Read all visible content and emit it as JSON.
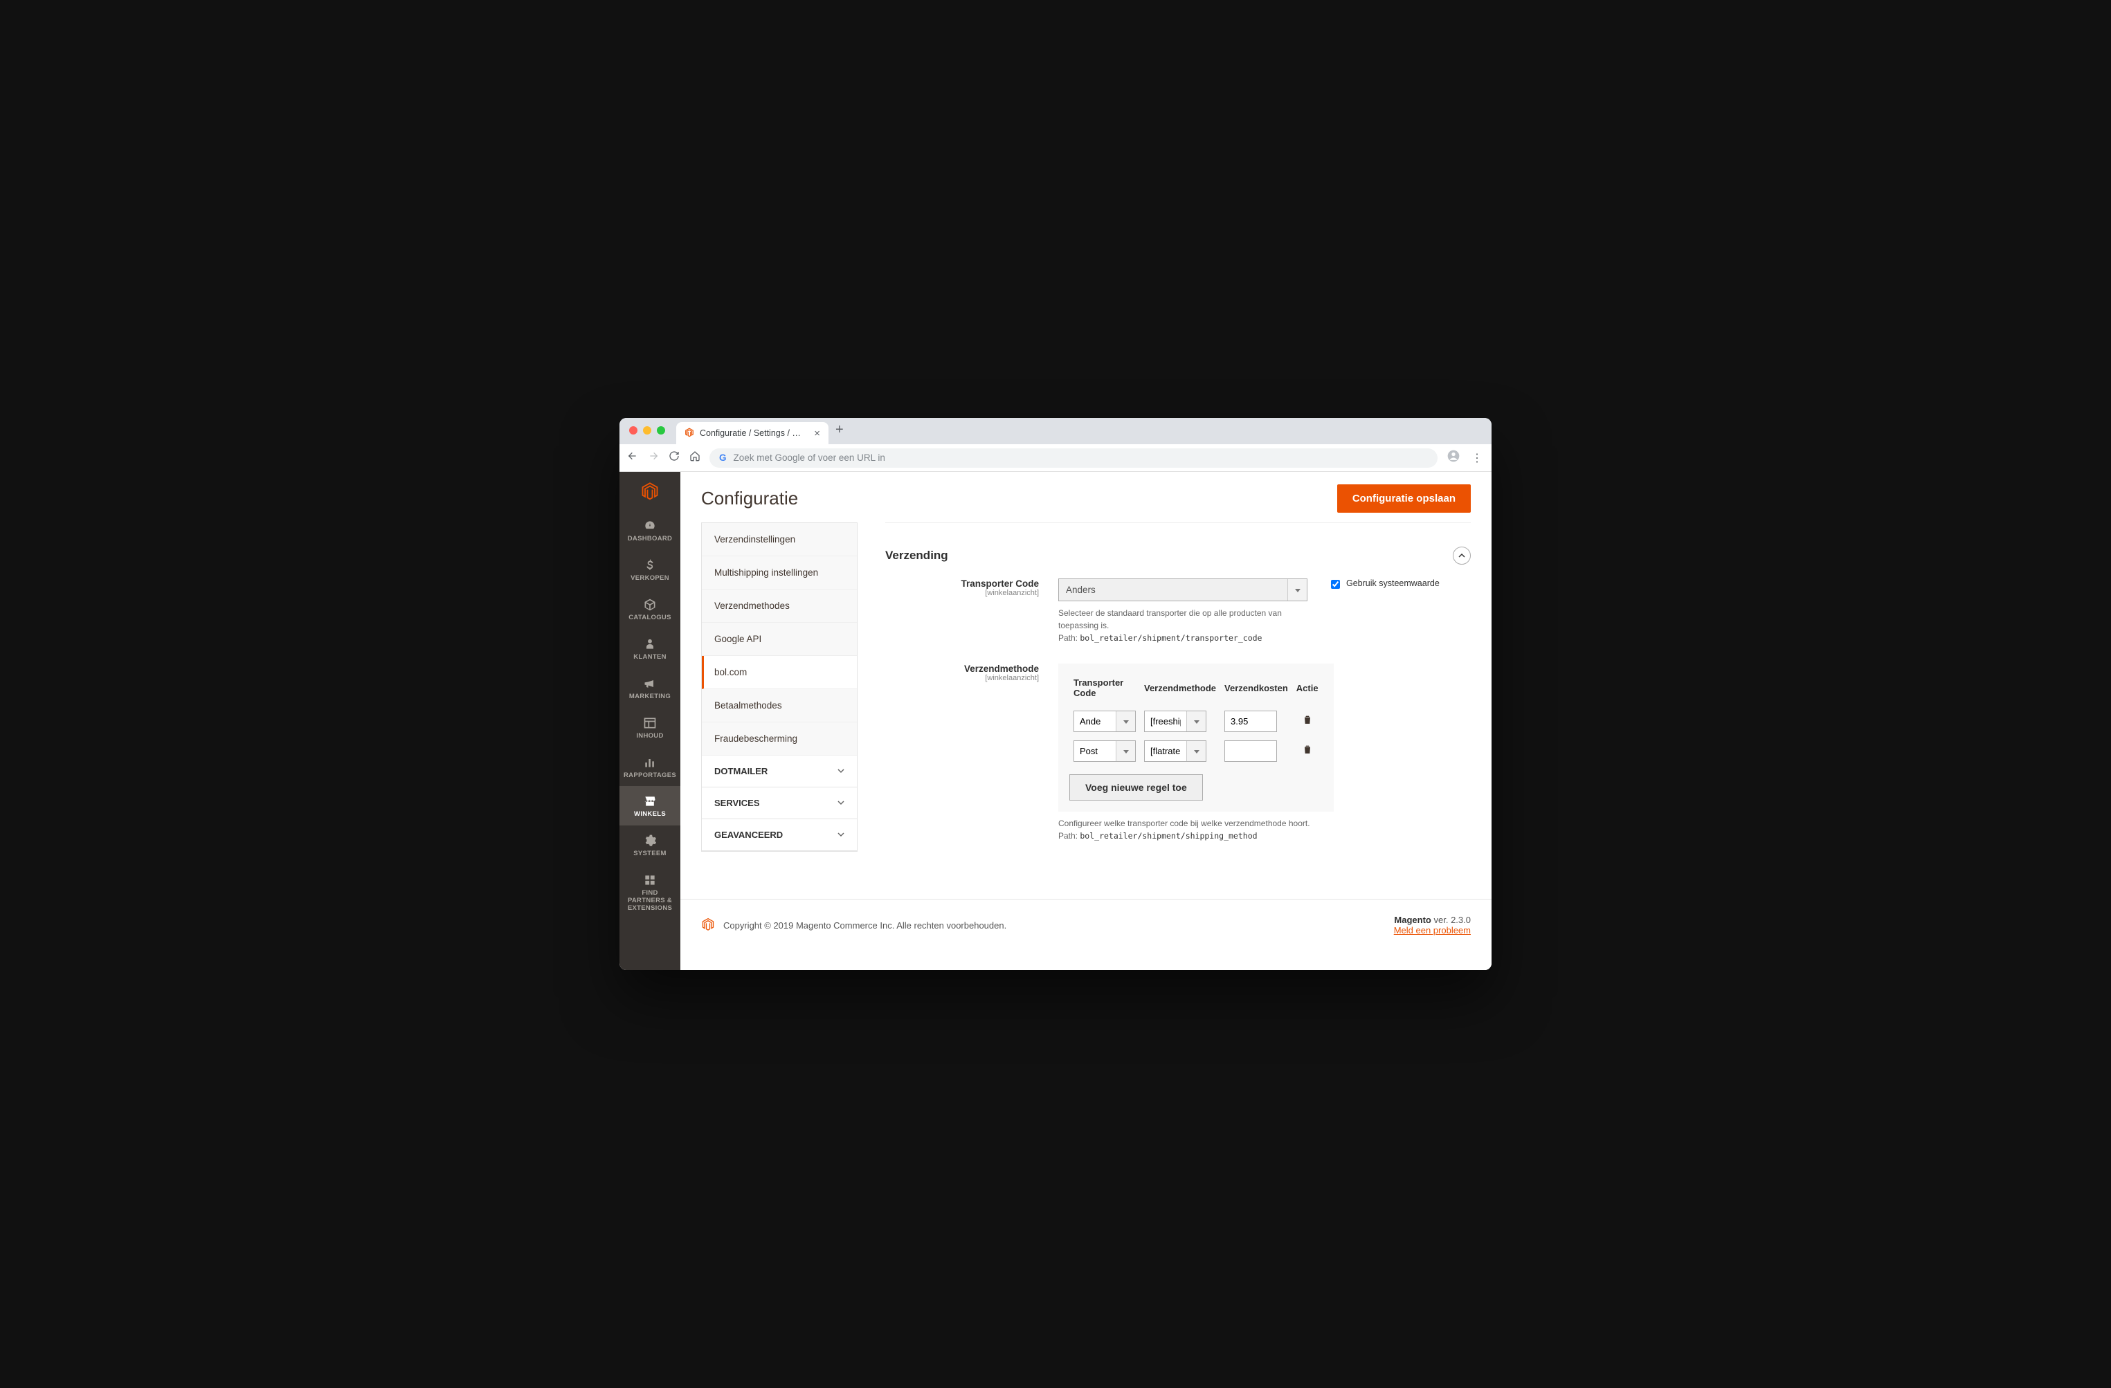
{
  "browser": {
    "tab_title": "Configuratie / Settings / Stores",
    "url_placeholder": "Zoek met Google of voer een URL in"
  },
  "sidebar_nav": [
    {
      "id": "dashboard",
      "label": "DASHBOARD",
      "icon": "gauge"
    },
    {
      "id": "verkopen",
      "label": "VERKOPEN",
      "icon": "dollar"
    },
    {
      "id": "catalogus",
      "label": "CATALOGUS",
      "icon": "box"
    },
    {
      "id": "klanten",
      "label": "KLANTEN",
      "icon": "person"
    },
    {
      "id": "marketing",
      "label": "MARKETING",
      "icon": "megaphone"
    },
    {
      "id": "inhoud",
      "label": "INHOUD",
      "icon": "layout"
    },
    {
      "id": "rapportages",
      "label": "RAPPORTAGES",
      "icon": "bars"
    },
    {
      "id": "winkels",
      "label": "WINKELS",
      "icon": "store",
      "active": true
    },
    {
      "id": "systeem",
      "label": "SYSTEEM",
      "icon": "gear"
    },
    {
      "id": "partners",
      "label": "FIND PARTNERS & EXTENSIONS",
      "icon": "blocks"
    }
  ],
  "page": {
    "title": "Configuratie",
    "save_button": "Configuratie opslaan"
  },
  "config_nav": {
    "items": [
      "Verzendinstellingen",
      "Multishipping instellingen",
      "Verzendmethodes",
      "Google API",
      "bol.com",
      "Betaalmethodes",
      "Fraudebescherming"
    ],
    "active_index": 4,
    "sections": [
      "DOTMAILER",
      "SERVICES",
      "GEAVANCEERD"
    ]
  },
  "fieldset": {
    "title": "Verzending",
    "transporter_code": {
      "label": "Transporter Code",
      "scope": "[winkelaanzicht]",
      "value": "Anders",
      "help": "Selecteer de standaard transporter die op alle producten van toepassing is.",
      "path_label": "Path:",
      "path": "bol_retailer/shipment/transporter_code",
      "use_default_label": "Gebruik systeemwaarde",
      "use_default_checked": true
    },
    "shipping_method": {
      "label": "Verzendmethode",
      "scope": "[winkelaanzicht]",
      "columns": [
        "Transporter Code",
        "Verzendmethode",
        "Verzendkosten",
        "Actie"
      ],
      "rows": [
        {
          "code": "Ande",
          "method": "[freeship",
          "cost": "3.95"
        },
        {
          "code": "Post",
          "method": "[flatrate",
          "cost": ""
        }
      ],
      "add_button": "Voeg nieuwe regel toe",
      "help": "Configureer welke transporter code bij welke verzendmethode hoort.",
      "path_label": "Path:",
      "path": "bol_retailer/shipment/shipping_method"
    }
  },
  "footer": {
    "copyright": "Copyright © 2019 Magento Commerce Inc. Alle rechten voorbehouden.",
    "product": "Magento",
    "version_label": "ver.",
    "version": "2.3.0",
    "report_link": "Meld een probleem"
  }
}
